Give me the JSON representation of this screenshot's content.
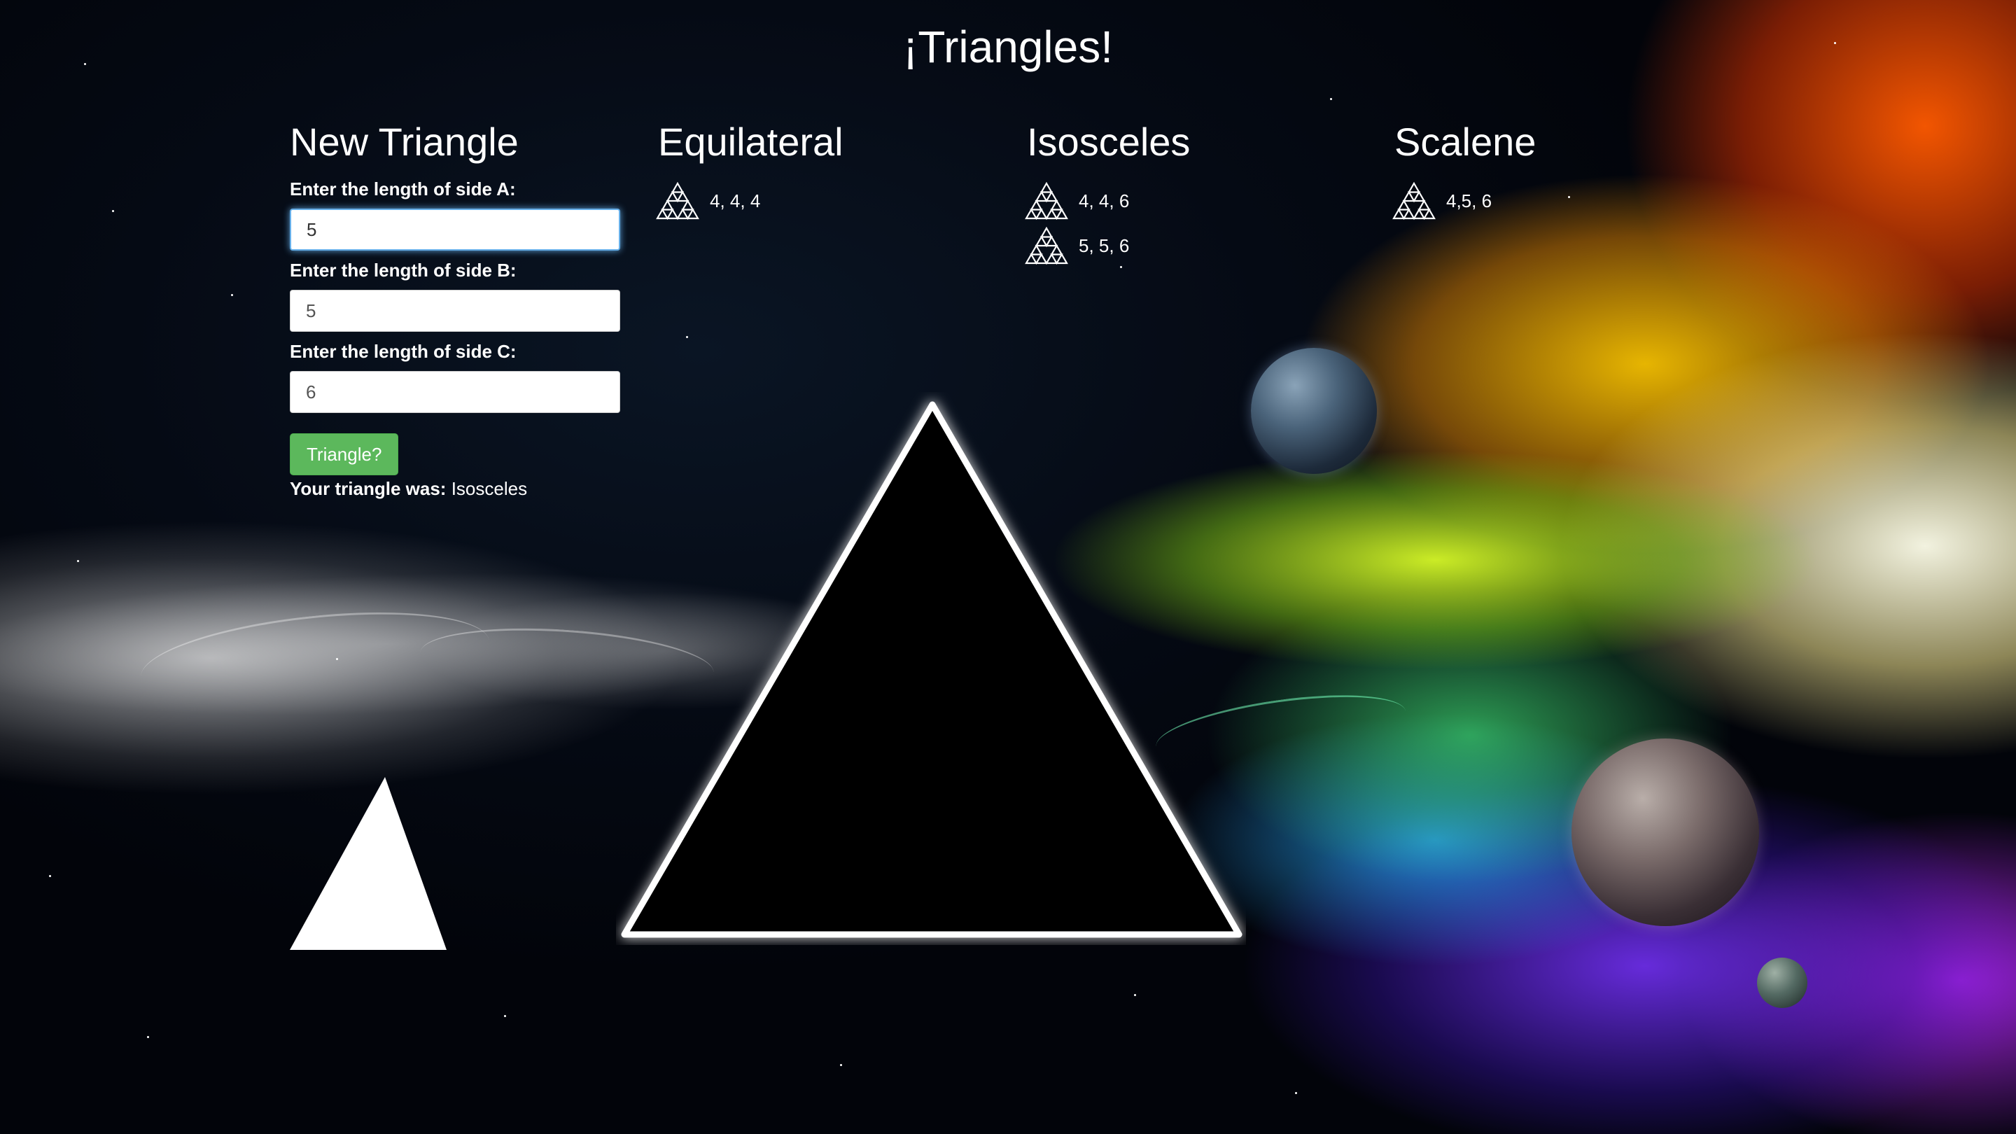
{
  "page": {
    "title": "¡Triangles!"
  },
  "form": {
    "heading": "New Triangle",
    "side_a": {
      "label": "Enter the length of side A:",
      "value": "5"
    },
    "side_b": {
      "label": "Enter the length of side B:",
      "value": "5"
    },
    "side_c": {
      "label": "Enter the length of side C:",
      "value": "6"
    },
    "submit_label": "Triangle?",
    "result_prefix": "Your triangle was:",
    "result_value": "Isosceles"
  },
  "columns": {
    "equilateral": {
      "heading": "Equilateral",
      "items": [
        "4, 4, 4"
      ]
    },
    "isosceles": {
      "heading": "Isosceles",
      "items": [
        "4, 4, 6",
        "5, 5, 6"
      ]
    },
    "scalene": {
      "heading": "Scalene",
      "items": [
        "4,5, 6"
      ]
    }
  },
  "icons": {
    "list_item": "sierpinski-triangle-icon",
    "prism": "prism-triangle",
    "white_triangle": "white-triangle"
  },
  "colors": {
    "button": "#5cb85c",
    "input_focus": "#66afe9",
    "text": "#ffffff",
    "prism_fill": "#000000"
  }
}
